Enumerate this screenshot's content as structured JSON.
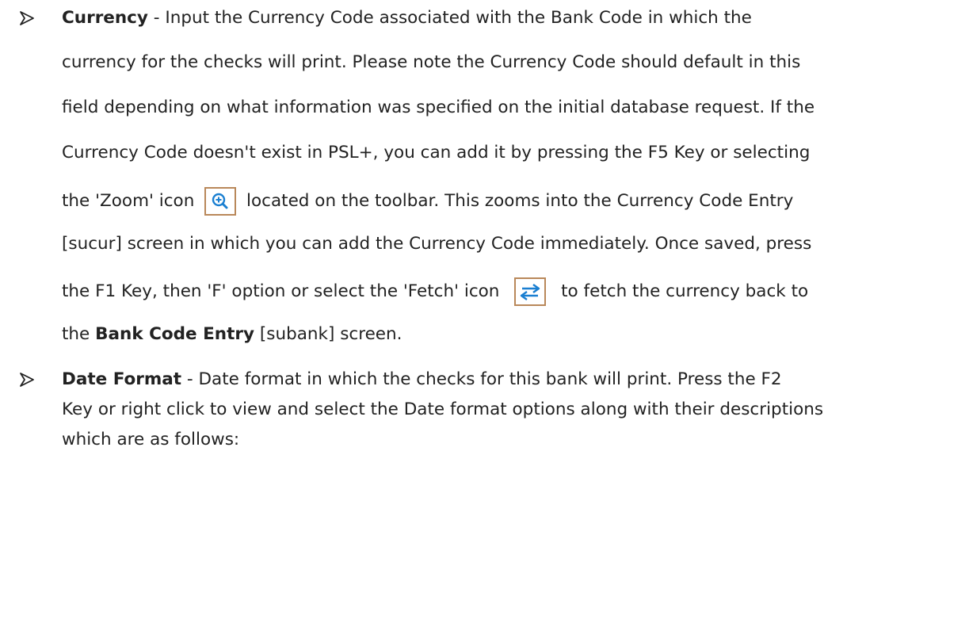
{
  "currency": {
    "heading": "Currency",
    "l1_tail": " - Input the Currency Code associated with the Bank Code in which the",
    "l2": "currency for the checks will print.  Please note the Currency Code should default in this",
    "l3": "field depending on what information was specified on the initial database request.  If the",
    "l4": "Currency Code doesn't exist in PSL+, you can add it by pressing the F5 Key or selecting",
    "l5_pre": "the 'Zoom' icon",
    "l5_post": "located on the toolbar.  This zooms into the Currency Code Entry",
    "l6": "[sucur] screen in which you can add the Currency Code immediately.  Once saved, press",
    "l7_pre": "the F1 Key, then 'F' option or select the 'Fetch' icon",
    "l7_post": "to fetch the currency back to",
    "l8_pre": "the ",
    "l8_bold": "Bank Code Entry",
    "l8_post": " [subank] screen."
  },
  "date_format": {
    "heading": "Date Format",
    "l1_tail": " - Date format in which the checks for this bank will print.  Press the F2",
    "l2": "Key or right click to view and select the Date format options along with their descriptions",
    "l3": "which are as follows:"
  },
  "icons": {
    "zoom": "zoom-icon",
    "fetch": "fetch-icon",
    "bullet": "arrow-bullet-icon"
  },
  "colors": {
    "text": "#222222",
    "icon_border": "#b9885a",
    "icon_blue": "#1a7fd1"
  }
}
